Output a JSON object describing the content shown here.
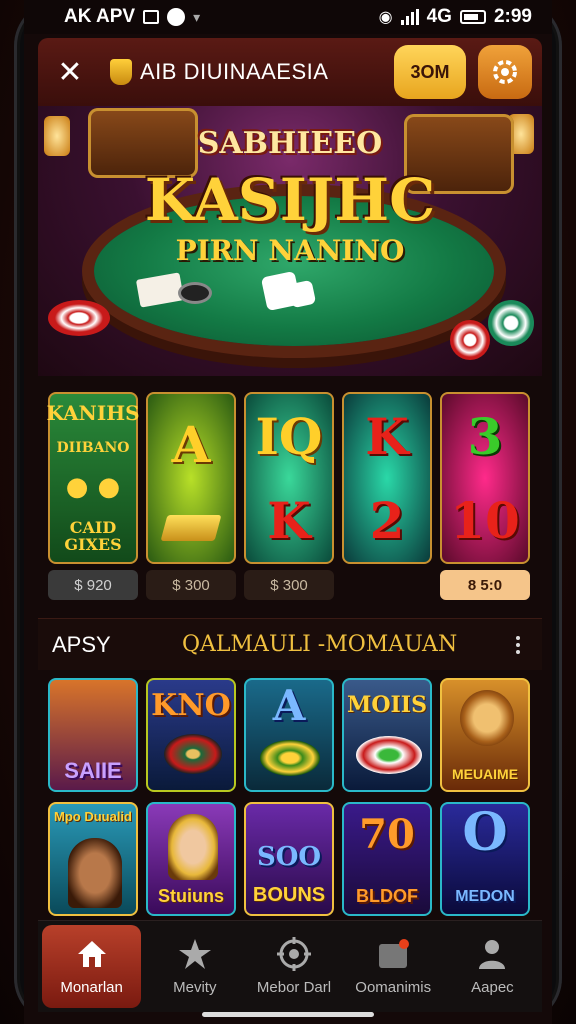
{
  "status_bar": {
    "left_text": "AK APV",
    "time": "2:99",
    "network": "4G"
  },
  "header": {
    "title": "AIB DIUINAAESIA",
    "gold_button_label": "3OM"
  },
  "hero": {
    "top_text": "SABHIEEO",
    "main_text": "KASIJHC",
    "sub_text": "PIRN NANINO"
  },
  "reels": [
    {
      "lines": [
        "KANIHS",
        "DIIBANO",
        "CAID GIXES"
      ]
    },
    {
      "symbol": "A"
    },
    {
      "symbol_top": "IQ",
      "symbol_bottom": "K"
    },
    {
      "symbol_top": "K",
      "symbol_bottom": "2"
    },
    {
      "symbol_top": "3",
      "symbol_bottom": "10"
    }
  ],
  "bet_pills": [
    "$ 920",
    "$ 300",
    "$ 300",
    "",
    "8 5:0"
  ],
  "section": {
    "left_label": "APSY",
    "title": "QALMAULI -MOMAUAN"
  },
  "games": [
    {
      "big": "",
      "label": "SAIIE"
    },
    {
      "big": "KNO",
      "label": ""
    },
    {
      "big": "A",
      "label": ""
    },
    {
      "big": "MOIIS",
      "label": ""
    },
    {
      "big": "",
      "label": "MEUAIME"
    },
    {
      "big": "",
      "label": "Mpo Duualid"
    },
    {
      "big": "",
      "label": "Stuiuns"
    },
    {
      "big": "SOO",
      "label": "BOUNS"
    },
    {
      "big": "70",
      "label": "BLDOF"
    },
    {
      "big": "O",
      "label": "MEDON"
    }
  ],
  "nav": {
    "items": [
      {
        "label": "Monarlan",
        "icon": "home-icon",
        "active": true
      },
      {
        "label": "Mevity",
        "icon": "star-icon",
        "active": false
      },
      {
        "label": "Mebor Darl",
        "icon": "target-icon",
        "active": false
      },
      {
        "label": "Oomanimis",
        "icon": "inbox-icon",
        "active": false
      },
      {
        "label": "Aapec",
        "icon": "user-icon",
        "active": false
      }
    ]
  },
  "colors": {
    "accent_gold": "#e8a51e",
    "accent_red": "#b8402a",
    "felt_green": "#137a45"
  }
}
